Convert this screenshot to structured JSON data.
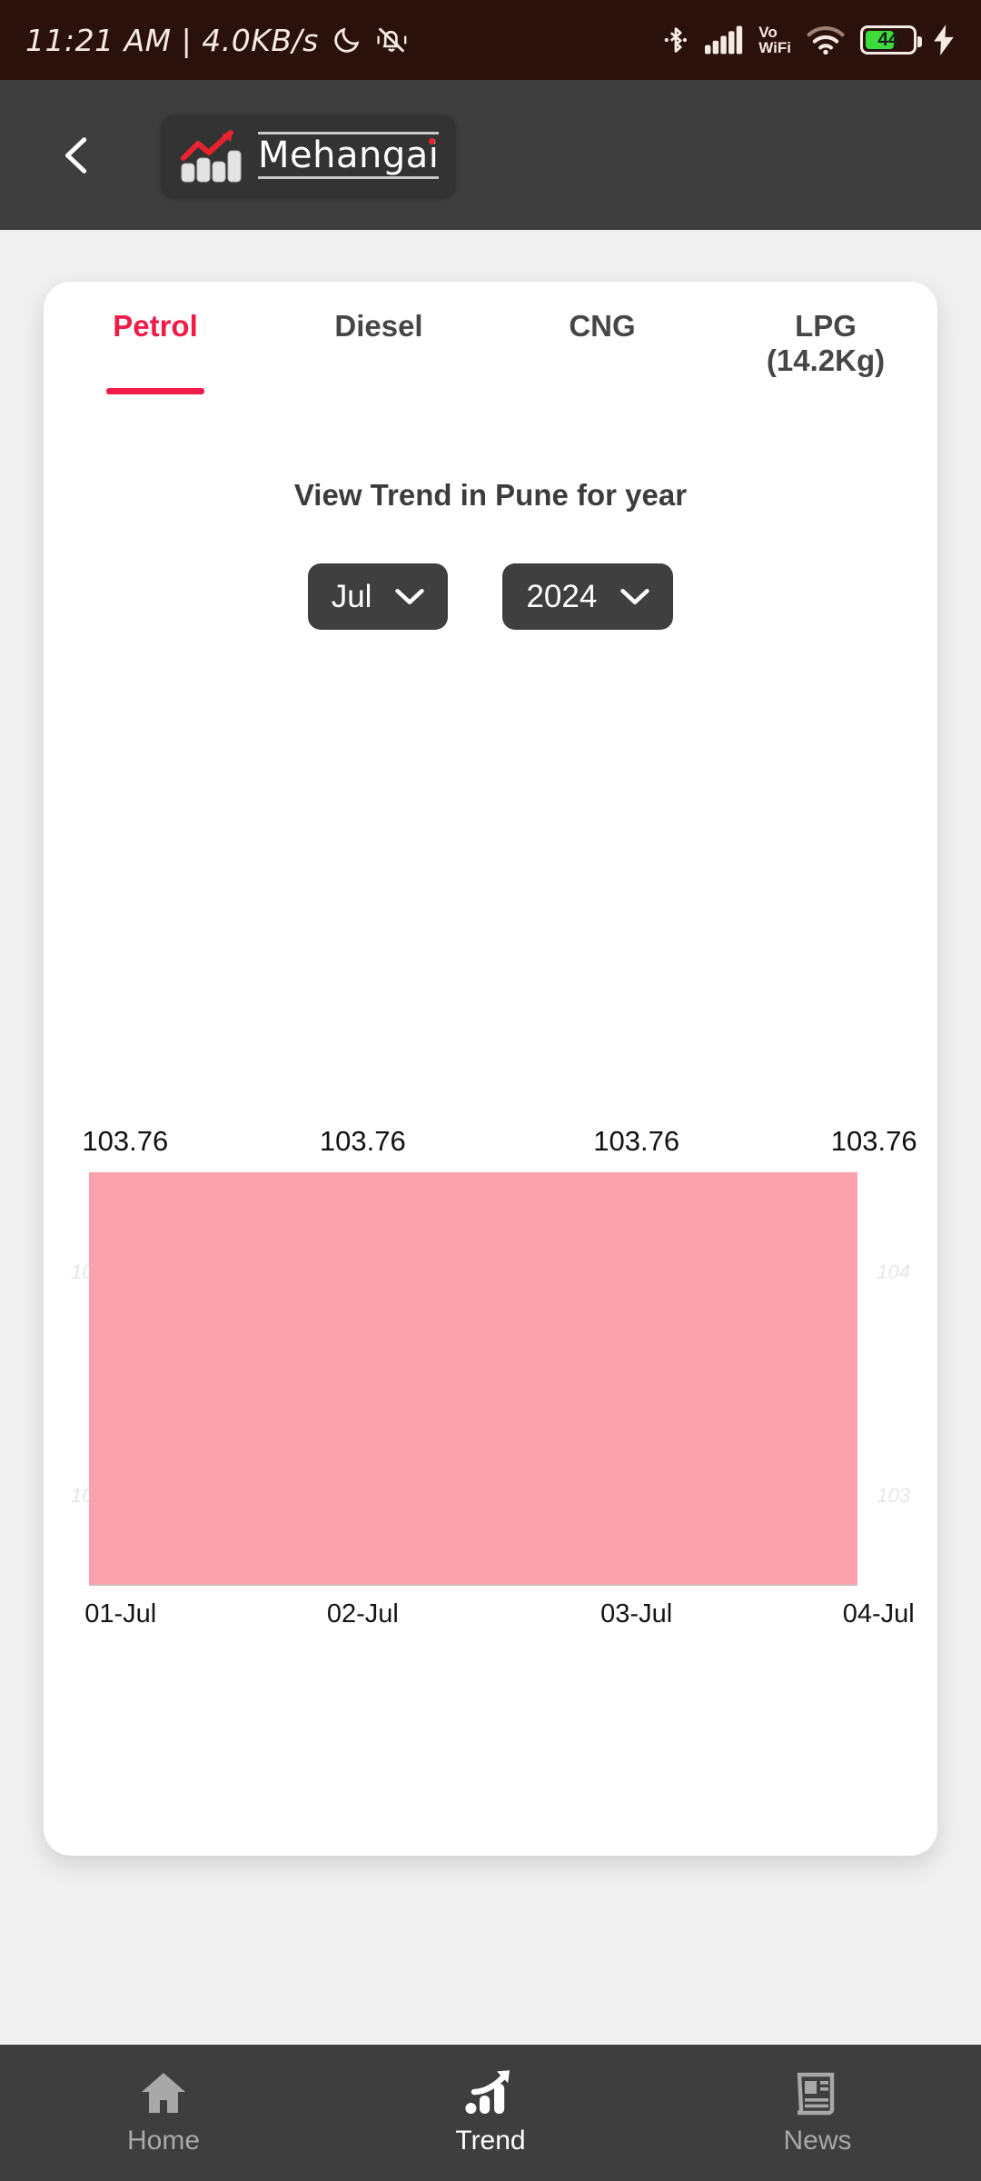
{
  "statusbar": {
    "time_text": "11:21 AM  |  4.0KB/s",
    "dnd_icon": "moon-icon",
    "silent_icon": "bell-slash-icon",
    "bluetooth_icon": "bluetooth-icon",
    "signal_icon": "cellular-signal-icon",
    "volte_line1": "Vo",
    "volte_line2": "WiFi",
    "wifi_icon": "wifi-icon",
    "battery_level": "44",
    "charging_icon": "charging-bolt-icon",
    "bg_color": "#2b110b",
    "battery_color": "#3ddc3d"
  },
  "appbar": {
    "back_icon": "back-chevron-icon",
    "logo_icon": "mehangai-logo-icon",
    "brand": "Mehangai",
    "bg_color": "#3e3e3e"
  },
  "card": {
    "tabs": [
      {
        "label": "Petrol",
        "active": true
      },
      {
        "label": "Diesel",
        "active": false
      },
      {
        "label": "CNG",
        "active": false
      },
      {
        "label": "LPG\n(14.2Kg)",
        "active": false
      }
    ],
    "trend_title": "View Trend in Pune for year",
    "month_select": {
      "value": "Jul",
      "chevron": "chevron-down-icon"
    },
    "year_select": {
      "value": "2024",
      "chevron": "chevron-down-icon"
    },
    "accent_color": "#ee1c48"
  },
  "chart_data": {
    "type": "area",
    "title": "View Trend in Pune for year",
    "xlabel": "",
    "ylabel": "",
    "categories": [
      "01-Jul",
      "02-Jul",
      "03-Jul",
      "04-Jul"
    ],
    "values": [
      103.76,
      103.76,
      103.76,
      103.76
    ],
    "point_labels": [
      "103.76",
      "103.76",
      "103.76",
      "103.76"
    ],
    "y_gridlines": [
      {
        "value": 104,
        "label_left": "104",
        "label_right": "104"
      },
      {
        "value": 103,
        "label_left": "103",
        "label_right": "103"
      }
    ],
    "ylim": [
      102.6,
      104.45
    ],
    "grid": true,
    "legend": "none",
    "series": [
      {
        "name": "Petrol",
        "values": [
          103.76,
          103.76,
          103.76,
          103.76
        ]
      }
    ],
    "fill_color": "#faa3af",
    "gridline_label_color": "#e6e6e6"
  },
  "bottomnav": {
    "items": [
      {
        "label": "Home",
        "icon": "home-icon",
        "active": false
      },
      {
        "label": "Trend",
        "icon": "trend-up-icon",
        "active": true
      },
      {
        "label": "News",
        "icon": "newspaper-icon",
        "active": false
      }
    ],
    "bg_color": "#3e3e3e"
  }
}
